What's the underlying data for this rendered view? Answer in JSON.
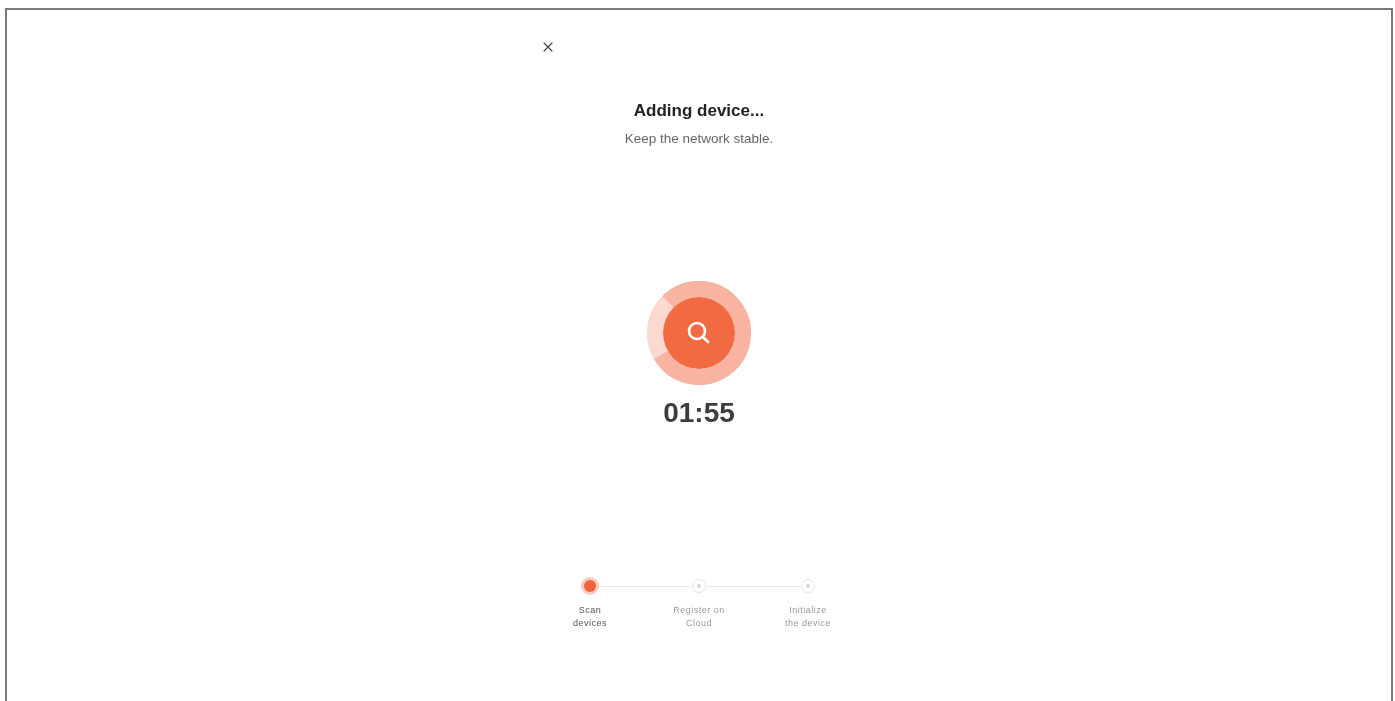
{
  "header": {
    "title": "Adding device...",
    "subtitle": "Keep the network stable."
  },
  "scan": {
    "timer": "01:55"
  },
  "steps": [
    {
      "label": "Scan devices",
      "active": true
    },
    {
      "label": "Register on Cloud",
      "active": false
    },
    {
      "label": "Initialize the device",
      "active": false
    }
  ]
}
